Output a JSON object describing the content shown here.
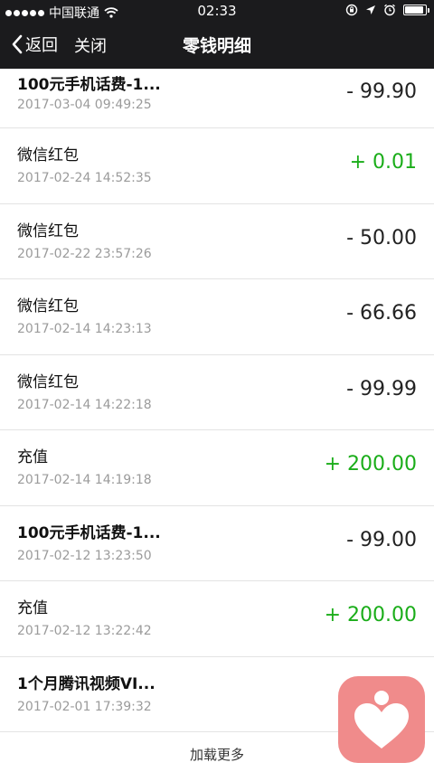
{
  "status_bar": {
    "carrier": "中国联通",
    "time": "02:33",
    "icons": [
      "signal-dots-icon",
      "wifi-icon",
      "rotation-lock-icon",
      "location-arrow-icon",
      "alarm-icon",
      "battery-icon"
    ],
    "battery_level": 0.9
  },
  "nav": {
    "back_label": "返回",
    "close_label": "关闭",
    "title": "零钱明细"
  },
  "transactions": [
    {
      "title": "100元手机话费-1...",
      "date": "2017-03-04 09:49:25",
      "amount": "- 99.90",
      "positive": false
    },
    {
      "title": "微信红包",
      "date": "2017-02-24 14:52:35",
      "amount": "+ 0.01",
      "positive": true
    },
    {
      "title": "微信红包",
      "date": "2017-02-22 23:57:26",
      "amount": "- 50.00",
      "positive": false
    },
    {
      "title": "微信红包",
      "date": "2017-02-14 14:23:13",
      "amount": "- 66.66",
      "positive": false
    },
    {
      "title": "微信红包",
      "date": "2017-02-14 14:22:18",
      "amount": "- 99.99",
      "positive": false
    },
    {
      "title": "充值",
      "date": "2017-02-14 14:19:18",
      "amount": "+ 200.00",
      "positive": true
    },
    {
      "title": "100元手机话费-1...",
      "date": "2017-02-12 13:23:50",
      "amount": "- 99.00",
      "positive": false
    },
    {
      "title": "充值",
      "date": "2017-02-12 13:22:42",
      "amount": "+ 200.00",
      "positive": true
    },
    {
      "title": "1个月腾讯视频VI...",
      "date": "2017-02-01 17:39:32",
      "amount": "",
      "positive": false
    }
  ],
  "load_more_label": "加载更多",
  "colors": {
    "bar_background": "#1b1b1d",
    "positive_amount": "#1aad19",
    "floating_app": "#f08b8b"
  },
  "floating_app": {
    "icon": "heart-person-icon"
  }
}
